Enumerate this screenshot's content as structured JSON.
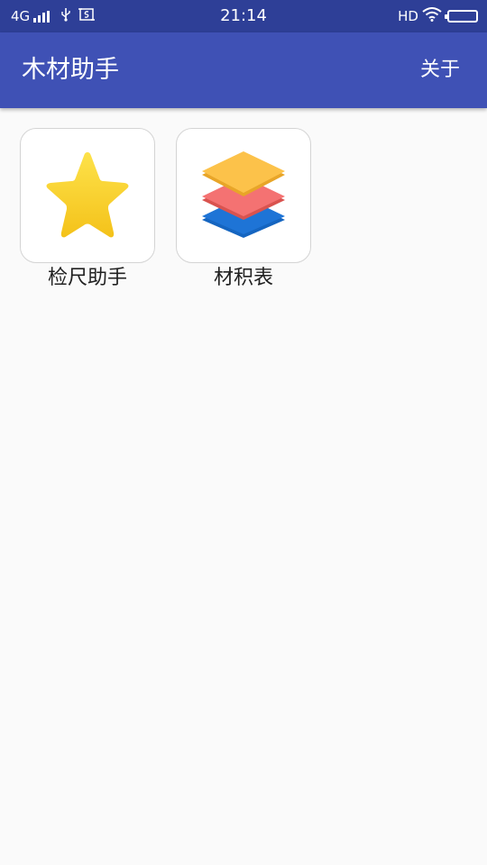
{
  "status_bar": {
    "network": "4G",
    "signal_icon": "signal-bars-icon",
    "usb_icon": "usb-icon",
    "screenshot_icon": "screenshot-icon",
    "time": "21:14",
    "hd": "HD",
    "wifi_icon": "wifi-icon",
    "battery_icon": "battery-icon"
  },
  "app_bar": {
    "title": "木材助手",
    "about_label": "关于",
    "color": "#3f51b5"
  },
  "grid": {
    "items": [
      {
        "label": "检尺助手",
        "icon": "star-icon",
        "icon_color": "#f7cf1d"
      },
      {
        "label": "材积表",
        "icon": "layers-icon",
        "icon_colors": [
          "#fbbf45",
          "#f26a6a",
          "#1e6fcf"
        ]
      }
    ]
  },
  "colors": {
    "status_bar": "#2e3f97",
    "background": "#fafafa"
  }
}
